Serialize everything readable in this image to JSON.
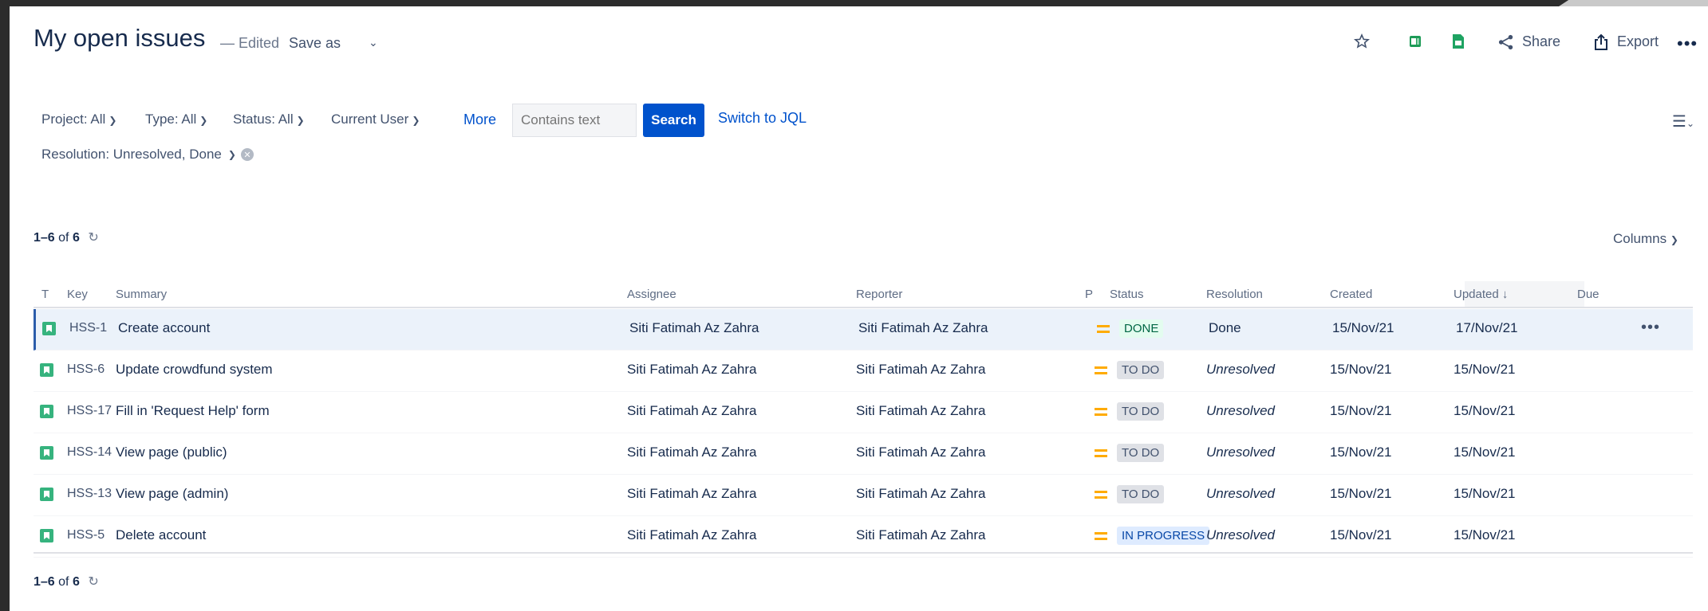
{
  "header": {
    "title": "My open issues",
    "edited": "— Edited",
    "save_as": "Save as",
    "share": "Share",
    "export": "Export",
    "icons": [
      "star-icon",
      "excel-icon",
      "sheets-icon",
      "share-icon",
      "export-icon",
      "more-icon"
    ]
  },
  "filters": {
    "project": "Project: All",
    "type": "Type: All",
    "status": "Status: All",
    "user": "Current User",
    "more": "More",
    "search_placeholder": "Contains text",
    "search_button": "Search",
    "switch_jql": "Switch to JQL",
    "resolution": "Resolution: Unresolved, Done"
  },
  "pagination": {
    "range": "1–6",
    "of": "of",
    "total": "6"
  },
  "columns_button": "Columns",
  "table": {
    "headers": {
      "t": "T",
      "key": "Key",
      "summary": "Summary",
      "assignee": "Assignee",
      "reporter": "Reporter",
      "p": "P",
      "status": "Status",
      "resolution": "Resolution",
      "created": "Created",
      "updated": "Updated",
      "due": "Due"
    },
    "rows": [
      {
        "key": "HSS-1",
        "summary": "Create account",
        "assignee": "Siti Fatimah Az Zahra",
        "reporter": "Siti Fatimah Az Zahra",
        "status": "DONE",
        "resolution": "Done",
        "created": "15/Nov/21",
        "updated": "17/Nov/21"
      },
      {
        "key": "HSS-6",
        "summary": "Update crowdfund system",
        "assignee": "Siti Fatimah Az Zahra",
        "reporter": "Siti Fatimah Az Zahra",
        "status": "TO DO",
        "resolution": "Unresolved",
        "created": "15/Nov/21",
        "updated": "15/Nov/21"
      },
      {
        "key": "HSS-17",
        "summary": "Fill in 'Request Help' form",
        "assignee": "Siti Fatimah Az Zahra",
        "reporter": "Siti Fatimah Az Zahra",
        "status": "TO DO",
        "resolution": "Unresolved",
        "created": "15/Nov/21",
        "updated": "15/Nov/21"
      },
      {
        "key": "HSS-14",
        "summary": "View page (public)",
        "assignee": "Siti Fatimah Az Zahra",
        "reporter": "Siti Fatimah Az Zahra",
        "status": "TO DO",
        "resolution": "Unresolved",
        "created": "15/Nov/21",
        "updated": "15/Nov/21"
      },
      {
        "key": "HSS-13",
        "summary": "View page (admin)",
        "assignee": "Siti Fatimah Az Zahra",
        "reporter": "Siti Fatimah Az Zahra",
        "status": "TO DO",
        "resolution": "Unresolved",
        "created": "15/Nov/21",
        "updated": "15/Nov/21"
      },
      {
        "key": "HSS-5",
        "summary": "Delete account",
        "assignee": "Siti Fatimah Az Zahra",
        "reporter": "Siti Fatimah Az Zahra",
        "status": "IN PROGRESS",
        "resolution": "Unresolved",
        "created": "15/Nov/21",
        "updated": "15/Nov/21"
      }
    ]
  },
  "colors": {
    "accent": "#0052cc",
    "done_bg": "#e3fcef",
    "done_text": "#006644",
    "progress_bg": "#deebff",
    "progress_text": "#0747a6",
    "priority_medium": "#ffab00",
    "story_icon": "#36b37e"
  }
}
